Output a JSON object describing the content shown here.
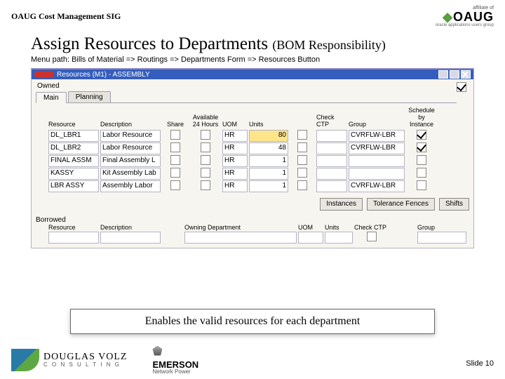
{
  "header": {
    "title": "OAUG Cost Management SIG",
    "oaug": {
      "affiliate": "affiliate of",
      "name": "OAUG",
      "sub": "oracle applications users group"
    }
  },
  "slide": {
    "title": "Assign Resources to Departments",
    "sub": "(BOM Responsibility)",
    "menu_path": "Menu path:  Bills of Material => Routings => Departments Form => Resources Button",
    "callout": "Enables the valid resources for each department",
    "slide_no": "Slide 10"
  },
  "form": {
    "window_title": "Resources (M1) - ASSEMBLY",
    "owned_label": "Owned",
    "tabs": {
      "main": "Main",
      "planning": "Planning"
    },
    "headers": {
      "resource": "Resource",
      "description": "Description",
      "share": "Share",
      "avail": "Available 24 Hours",
      "uom": "UOM",
      "units": "Units",
      "ctp_chk": "",
      "check_ctp": "Check CTP",
      "group": "Group",
      "sched": "Schedule by Instance"
    },
    "rows": [
      {
        "res": "DL_LBR1",
        "desc": "Labor Resource",
        "uom": "HR",
        "units": "80",
        "group": "CVRFLW-LBR",
        "sched": true,
        "hl": true
      },
      {
        "res": "DL_LBR2",
        "desc": "Labor Resource",
        "uom": "HR",
        "units": "48",
        "group": "CVRFLW-LBR",
        "sched": true,
        "hl": false
      },
      {
        "res": "FINAL ASSM",
        "desc": "Final Assembly L",
        "uom": "HR",
        "units": "1",
        "group": "",
        "sched": false,
        "hl": false
      },
      {
        "res": "KASSY",
        "desc": "Kit Assembly Lab",
        "uom": "HR",
        "units": "1",
        "group": "",
        "sched": false,
        "hl": false
      },
      {
        "res": "LBR ASSY",
        "desc": "Assembly Labor",
        "uom": "HR",
        "units": "1",
        "group": "CVRFLW-LBR",
        "sched": false,
        "hl": false
      }
    ],
    "buttons": {
      "instances": "Instances",
      "fences": "Tolerance Fences",
      "shifts": "Shifts"
    },
    "borrowed": {
      "label": "Borrowed",
      "headers": {
        "resource": "Resource",
        "description": "Description",
        "own_dept": "Owning Department",
        "uom": "UOM",
        "units": "Units",
        "check_ctp": "Check CTP",
        "group": "Group"
      }
    }
  },
  "footer": {
    "dv1": "DOUGLAS VOLZ",
    "dv2": "C O N S U L T I N G",
    "em1": "EMERSON",
    "em2": "Network Power"
  }
}
